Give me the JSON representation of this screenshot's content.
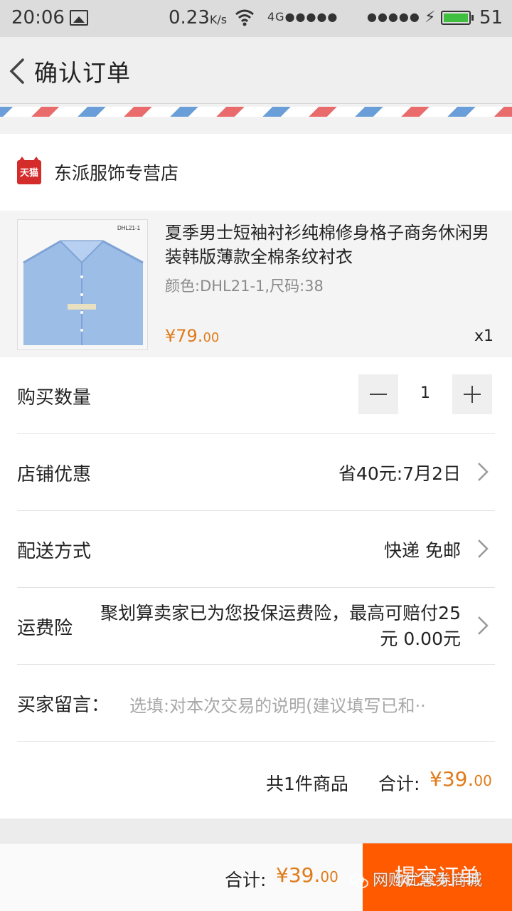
{
  "status_bar": {
    "time": "20:06",
    "speed": "0.23",
    "speed_unit": "K/s",
    "network_label": "4G",
    "signal_dots_1": "●●●●●",
    "signal_dots_2": "●●●●●",
    "battery_level": "51"
  },
  "header": {
    "title": "确认订单"
  },
  "shop": {
    "logo_text": "天猫",
    "name": "东派服饰专营店"
  },
  "product": {
    "thumb_label": "DHL21-1",
    "title": "夏季男士短袖衬衫纯棉修身格子商务休闲男装韩版薄款全棉条纹衬衣",
    "spec": "颜色:DHL21-1,尺码:38",
    "price_main": "¥79.",
    "price_decimal": "00",
    "quantity": "x1"
  },
  "rows": {
    "quantity": {
      "label": "购买数量",
      "value": "1"
    },
    "discount": {
      "label": "店铺优惠",
      "value": "省40元:7月2日"
    },
    "delivery": {
      "label": "配送方式",
      "value": "快递 免邮"
    },
    "insurance": {
      "label": "运费险",
      "value": "聚划算卖家已为您投保运费险，最高可赔付25元 0.00元"
    },
    "note": {
      "label": "买家留言：",
      "placeholder": "选填:对本次交易的说明(建议填写已和··"
    }
  },
  "summary": {
    "count": "共1件商品",
    "total_label": "合计:",
    "total_main": "¥39.",
    "total_decimal": "00"
  },
  "bottom_bar": {
    "total_label": "合计:",
    "total_main": "¥39.",
    "total_decimal": "00",
    "submit_label": "提交订单",
    "watermark": "网购优惠券商城"
  },
  "colors": {
    "accent": "#ff5a00",
    "price": "#e07b1a",
    "tmall_red": "#d42b2b"
  }
}
